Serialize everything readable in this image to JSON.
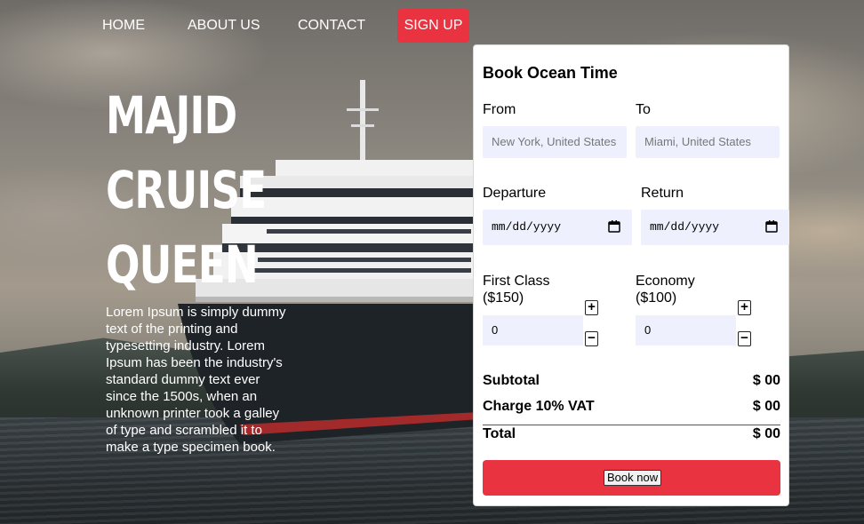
{
  "nav": {
    "home": "HOME",
    "about": "ABOUT US",
    "contact": "CONTACT",
    "signup": "SIGN UP"
  },
  "hero": {
    "title_line1": "MAJID",
    "title_line2": "CRUISE",
    "title_line3": "QUEEN",
    "description": "Lorem Ipsum is simply dummy text of the printing and typesetting industry. Lorem Ipsum has been the industry's standard dummy text ever since the 1500s, when an unknown printer took a galley of type and scrambled it to make a type specimen book."
  },
  "booking": {
    "title": "Book Ocean Time",
    "from_label": "From",
    "from_value": "New York, United States",
    "to_label": "To",
    "to_value": "Miami, United States",
    "departure_label": "Departure",
    "departure_value": "mm/dd/yyyy",
    "return_label": "Return",
    "return_value": "mm/dd/yyyy",
    "first_class_label_1": "First Class",
    "first_class_label_2": "($150)",
    "first_class_qty": "0",
    "economy_label_1": "Economy",
    "economy_label_2": "($100)",
    "economy_qty": "0",
    "plus": "+",
    "minus": "−",
    "subtotal_label": "Subtotal",
    "subtotal_value": "$ 00",
    "vat_label": "Charge 10% VAT",
    "vat_value": "$ 00",
    "total_label": "Total",
    "total_value": "$ 00",
    "book_button": "Book now"
  },
  "colors": {
    "accent": "#ea3341",
    "field_bg": "#eef0fd",
    "card_bg": "#ffffff"
  },
  "icons": [
    "calendar-icon",
    "plus-icon",
    "minus-icon"
  ]
}
